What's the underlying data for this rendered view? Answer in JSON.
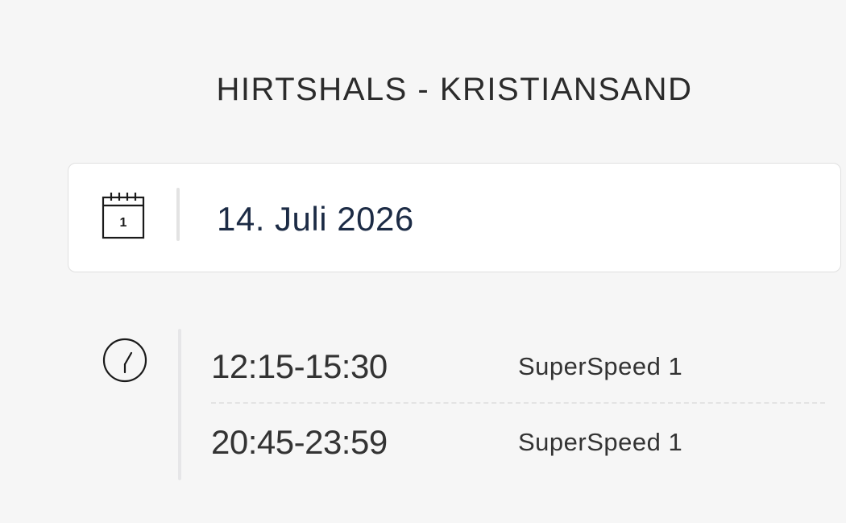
{
  "route": {
    "title": "HIRTSHALS - KRISTIANSAND"
  },
  "date_selector": {
    "icon": "calendar-icon",
    "icon_day": "1",
    "value": "14. Juli 2026",
    "text_color": "#1c2b45"
  },
  "departures": {
    "icon": "clock-icon",
    "items": [
      {
        "time": "12:15-15:30",
        "vessel": "SuperSpeed 1"
      },
      {
        "time": "20:45-23:59",
        "vessel": "SuperSpeed 1"
      }
    ]
  },
  "colors": {
    "background": "#f6f6f6",
    "card": "#ffffff",
    "text": "#333333"
  }
}
